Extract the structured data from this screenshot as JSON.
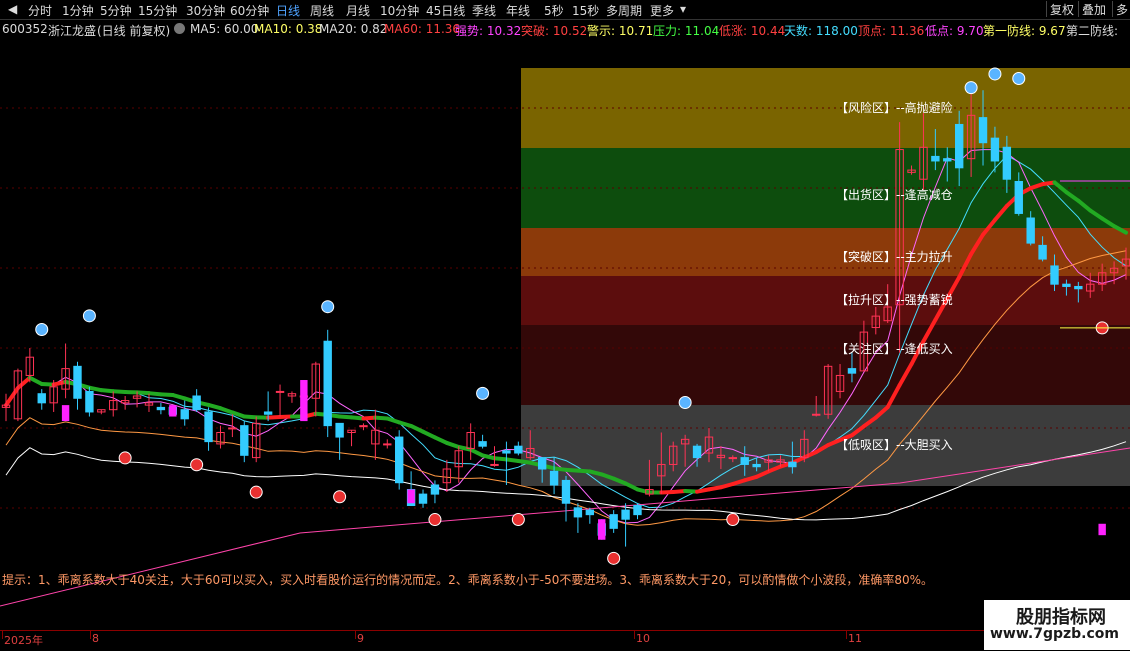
{
  "toolbar": {
    "periods": [
      "分时",
      "1分钟",
      "5分钟",
      "15分钟",
      "30分钟",
      "60分钟",
      "日线",
      "周线",
      "月线",
      "10分钟",
      "45日线",
      "季线",
      "年线",
      "5秒",
      "15秒",
      "多周期",
      "更多"
    ],
    "active_index": 6,
    "restore_label": "复权",
    "overlay_label": "叠加",
    "more_label": "多"
  },
  "stock": {
    "code": "600352",
    "name": "浙江龙盛",
    "period_info": "(日线 前复权)"
  },
  "indicators": [
    {
      "label": "MA5: 60.00",
      "color": "#dcdcdc"
    },
    {
      "label": "MA10: 0.38",
      "color": "#ffff66"
    },
    {
      "label": "MA20: 0.82",
      "color": "#dcdcdc"
    },
    {
      "label": "MA60: 11.36",
      "color": "#ff4040"
    },
    {
      "label": "强势: 10.32",
      "color": "#ff44ff"
    },
    {
      "label": "突破: 10.52",
      "color": "#ff4040"
    },
    {
      "label": "警示: 10.71",
      "color": "#ffff66"
    },
    {
      "label": "压力: 11.04",
      "color": "#44ff44"
    },
    {
      "label": "低涨: 10.44",
      "color": "#ff4040"
    },
    {
      "label": "天数: 118.00",
      "color": "#44ddff"
    },
    {
      "label": "顶点: 11.36",
      "color": "#ff4040"
    },
    {
      "label": "低点: 9.70",
      "color": "#ff44ff"
    },
    {
      "label": "第一防线: 9.67",
      "color": "#ffff66"
    },
    {
      "label": "第二防线:",
      "color": "#dcdcdc"
    }
  ],
  "zones": [
    {
      "label": "【风险区】--高抛避险",
      "color": "#7a6400"
    },
    {
      "label": "【出货区】--逢高减仓",
      "color": "#0d4d0d"
    },
    {
      "label": "【突破区】--主力拉升",
      "color": "#8c3a0a"
    },
    {
      "label": "【拉升区】--强势蓄锐",
      "color": "#5c0d0d"
    },
    {
      "label": "【关注区】--逢低买入",
      "color": "#330808"
    },
    {
      "label": "【低吸区】--大胆买入",
      "color": "#3c3c3c"
    }
  ],
  "tip": "提示：1、乖离系数大于40关注，大于60可以买入，买入时看股价运行的情况而定。2、乖离系数小于-50不要进场。3、乖离系数大于20，可以酌情做个小波段，准确率80%。",
  "dates": [
    "2025年",
    "8",
    "9",
    "10",
    "11"
  ],
  "watermark": {
    "line1": "股朋指标网",
    "line2": "www.7gpzb.com"
  },
  "chart_data": {
    "type": "candlestick",
    "y_range": [
      9.3,
      11.5
    ],
    "candles": [
      [
        9.96,
        9.97,
        9.9,
        10.02
      ],
      [
        9.91,
        10.12,
        9.9,
        10.13
      ],
      [
        10.1,
        10.18,
        10.07,
        10.22
      ],
      [
        10.02,
        9.98,
        9.95,
        10.04
      ],
      [
        9.98,
        10.05,
        9.94,
        10.08
      ],
      [
        10.04,
        10.13,
        10.0,
        10.24
      ],
      [
        10.14,
        10.0,
        9.95,
        10.16
      ],
      [
        10.03,
        9.94,
        9.92,
        10.05
      ],
      [
        9.94,
        9.95,
        9.93,
        9.95
      ],
      [
        9.95,
        9.99,
        9.92,
        10.03
      ],
      [
        9.98,
        9.99,
        9.95,
        10.01
      ],
      [
        10.0,
        10.01,
        9.96,
        10.03
      ],
      [
        9.97,
        9.98,
        9.94,
        10.02
      ],
      [
        9.96,
        9.95,
        9.93,
        9.98
      ],
      [
        9.96,
        9.93,
        9.92,
        9.97
      ],
      [
        9.95,
        9.91,
        9.88,
        9.99
      ],
      [
        10.01,
        9.95,
        9.94,
        10.04
      ],
      [
        9.94,
        9.81,
        9.77,
        9.96
      ],
      [
        9.8,
        9.85,
        9.78,
        9.88
      ],
      [
        9.87,
        9.87,
        9.83,
        9.93
      ],
      [
        9.88,
        9.75,
        9.72,
        9.9
      ],
      [
        9.74,
        9.89,
        9.72,
        9.92
      ],
      [
        9.94,
        9.93,
        9.9,
        10.03
      ],
      [
        10.03,
        10.03,
        9.92,
        10.06
      ],
      [
        10.01,
        10.02,
        9.98,
        10.03
      ],
      [
        10.01,
        10.01,
        9.98,
        10.02
      ],
      [
        10.0,
        10.15,
        9.92,
        10.16
      ],
      [
        10.25,
        9.88,
        9.83,
        10.3
      ],
      [
        9.89,
        9.83,
        9.73,
        9.89
      ],
      [
        9.85,
        9.86,
        9.79,
        9.86
      ],
      [
        9.88,
        9.88,
        9.86,
        9.89
      ],
      [
        9.8,
        9.86,
        9.73,
        9.95
      ],
      [
        9.8,
        9.8,
        9.78,
        9.82
      ],
      [
        9.83,
        9.63,
        9.6,
        9.86
      ],
      [
        9.6,
        9.53,
        9.53,
        9.68
      ],
      [
        9.58,
        9.54,
        9.52,
        9.6
      ],
      [
        9.62,
        9.58,
        9.54,
        9.64
      ],
      [
        9.63,
        9.69,
        9.59,
        9.73
      ],
      [
        9.7,
        9.77,
        9.63,
        9.79
      ],
      [
        9.78,
        9.85,
        9.73,
        9.89
      ],
      [
        9.81,
        9.79,
        9.78,
        9.84
      ],
      [
        9.71,
        9.71,
        9.7,
        9.79
      ],
      [
        9.77,
        9.76,
        9.62,
        9.81
      ],
      [
        9.79,
        9.76,
        9.75,
        9.81
      ],
      [
        9.74,
        9.78,
        9.73,
        9.86
      ],
      [
        9.74,
        9.69,
        9.63,
        9.74
      ],
      [
        9.68,
        9.62,
        9.58,
        9.74
      ],
      [
        9.64,
        9.54,
        9.46,
        9.66
      ],
      [
        9.52,
        9.48,
        9.41,
        9.54
      ],
      [
        9.51,
        9.49,
        9.45,
        9.52
      ],
      [
        9.45,
        9.4,
        9.38,
        9.47
      ],
      [
        9.49,
        9.43,
        9.41,
        9.51
      ],
      [
        9.51,
        9.47,
        9.35,
        9.54
      ],
      [
        9.53,
        9.49,
        9.47,
        9.54
      ],
      [
        9.58,
        9.6,
        9.57,
        9.73
      ],
      [
        9.66,
        9.71,
        9.58,
        9.85
      ],
      [
        9.71,
        9.79,
        9.68,
        9.81
      ],
      [
        9.8,
        9.82,
        9.7,
        9.84
      ],
      [
        9.79,
        9.74,
        9.7,
        9.8
      ],
      [
        9.76,
        9.83,
        9.72,
        9.87
      ],
      [
        9.74,
        9.75,
        9.69,
        9.79
      ],
      [
        9.74,
        9.74,
        9.72,
        9.75
      ],
      [
        9.74,
        9.71,
        9.66,
        9.79
      ],
      [
        9.71,
        9.7,
        9.68,
        9.74
      ],
      [
        9.72,
        9.73,
        9.68,
        9.75
      ],
      [
        9.72,
        9.73,
        9.7,
        9.75
      ],
      [
        9.72,
        9.7,
        9.67,
        9.81
      ],
      [
        9.74,
        9.82,
        9.72,
        9.86
      ],
      [
        9.93,
        9.93,
        9.92,
        10.01
      ],
      [
        9.93,
        10.14,
        9.91,
        10.15
      ],
      [
        10.03,
        10.1,
        10.0,
        10.15
      ],
      [
        10.13,
        10.11,
        10.07,
        10.2
      ],
      [
        10.12,
        10.29,
        10.12,
        10.34
      ],
      [
        10.31,
        10.36,
        10.28,
        10.4
      ],
      [
        10.34,
        10.4,
        10.33,
        10.5
      ],
      [
        10.41,
        11.09,
        10.2,
        11.21
      ],
      [
        10.99,
        11.0,
        10.98,
        11.02
      ],
      [
        10.96,
        11.1,
        10.91,
        11.25
      ],
      [
        11.06,
        11.04,
        11.0,
        11.18
      ],
      [
        11.05,
        11.04,
        10.95,
        11.1
      ],
      [
        11.2,
        11.01,
        10.93,
        11.26
      ],
      [
        11.05,
        11.24,
        10.97,
        11.36
      ],
      [
        11.23,
        11.12,
        11.02,
        11.35
      ],
      [
        11.14,
        11.04,
        10.99,
        11.19
      ],
      [
        11.1,
        10.96,
        10.9,
        11.15
      ],
      [
        10.95,
        10.81,
        10.8,
        10.99
      ],
      [
        10.79,
        10.68,
        10.67,
        10.82
      ],
      [
        10.67,
        10.61,
        10.6,
        10.71
      ],
      [
        10.58,
        10.5,
        10.47,
        10.63
      ],
      [
        10.5,
        10.49,
        10.45,
        10.52
      ],
      [
        10.49,
        10.48,
        10.42,
        10.51
      ],
      [
        10.47,
        10.5,
        10.44,
        10.55
      ],
      [
        10.5,
        10.55,
        10.47,
        10.59
      ],
      [
        10.55,
        10.57,
        10.5,
        10.6
      ],
      [
        10.58,
        10.61,
        10.52,
        10.66
      ]
    ]
  }
}
